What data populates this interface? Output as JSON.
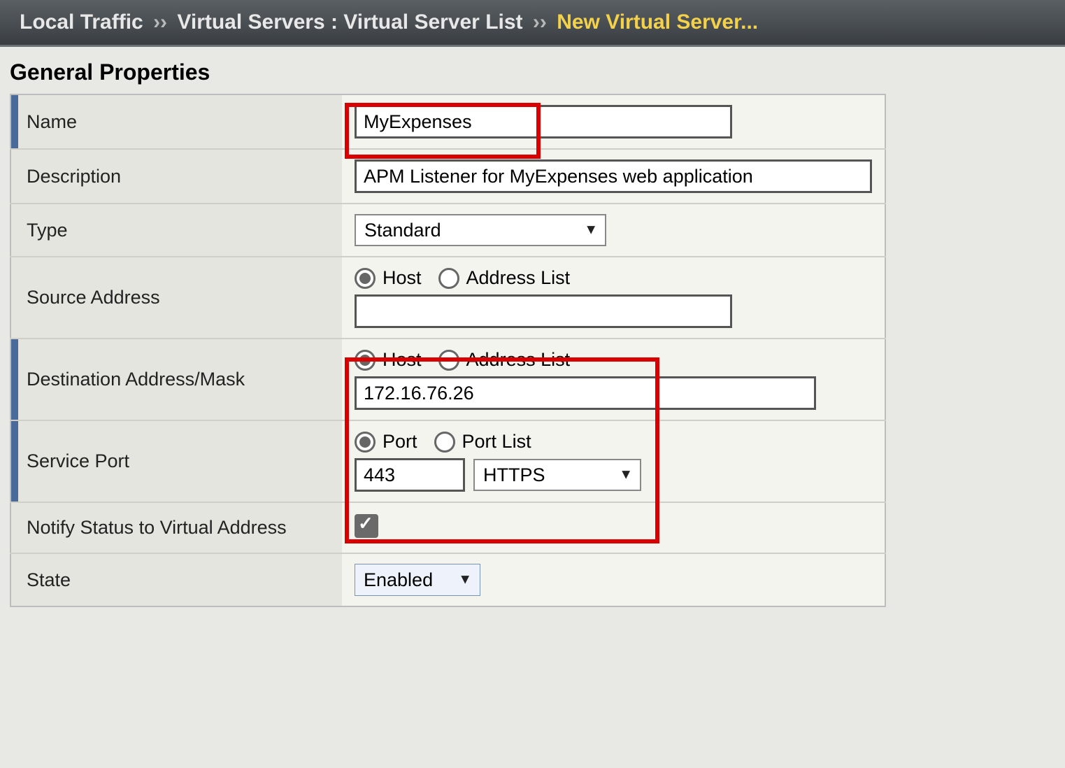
{
  "breadcrumb": {
    "segment1": "Local Traffic",
    "segment2": "Virtual Servers : Virtual Server List",
    "segment3": "New Virtual Server...",
    "sep": "››"
  },
  "section_title": "General Properties",
  "rows": {
    "name": {
      "label": "Name",
      "value": "MyExpenses"
    },
    "description": {
      "label": "Description",
      "value": "APM Listener for MyExpenses web application"
    },
    "type": {
      "label": "Type",
      "selected": "Standard"
    },
    "source_address": {
      "label": "Source Address",
      "radio_host": "Host",
      "radio_list": "Address List",
      "value": ""
    },
    "dest_address": {
      "label": "Destination Address/Mask",
      "radio_host": "Host",
      "radio_list": "Address List",
      "value": "172.16.76.26"
    },
    "service_port": {
      "label": "Service Port",
      "radio_port": "Port",
      "radio_portlist": "Port List",
      "port_value": "443",
      "protocol_selected": "HTTPS"
    },
    "notify_status": {
      "label": "Notify Status to Virtual Address",
      "checked": true
    },
    "state": {
      "label": "State",
      "selected": "Enabled"
    }
  }
}
